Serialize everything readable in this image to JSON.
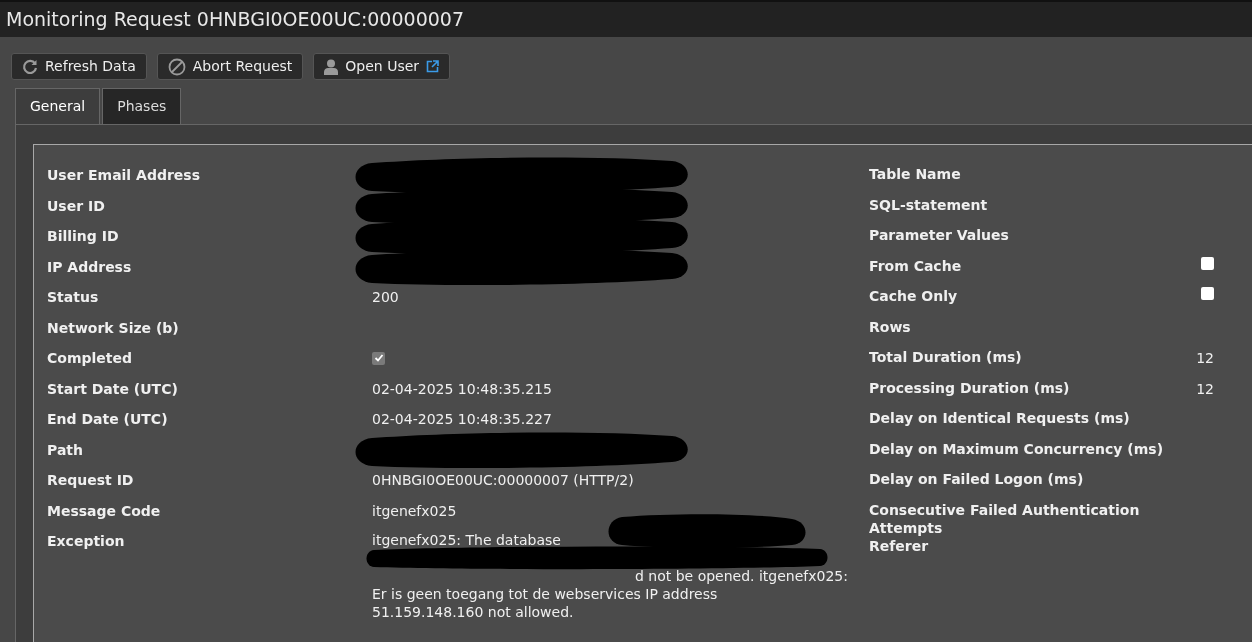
{
  "window": {
    "title": "Monitoring Request 0HNBGI0OE00UC:00000007"
  },
  "toolbar": [
    {
      "label": "Refresh Data"
    },
    {
      "label": "Abort Request"
    },
    {
      "label": "Open User"
    }
  ],
  "tabs": [
    {
      "label": "General",
      "selected": true
    },
    {
      "label": "Phases",
      "selected": false
    }
  ],
  "left_fields": [
    {
      "label": "User Email Address",
      "kind": "text",
      "redacted": true
    },
    {
      "label": "User ID",
      "kind": "text",
      "redacted": true
    },
    {
      "label": "Billing ID",
      "kind": "text",
      "redacted": true
    },
    {
      "label": "IP Address",
      "kind": "text",
      "redacted": true
    },
    {
      "label": "Status",
      "kind": "text",
      "value": "200",
      "redacted": false
    },
    {
      "label": "Network Size (b)",
      "kind": "text",
      "redacted": false
    },
    {
      "label": "Completed",
      "kind": "checkbox",
      "checked": true,
      "redacted": false
    },
    {
      "label": "Start Date (UTC)",
      "kind": "text",
      "value": "02-04-2025 10:48:35.215",
      "redacted": false
    },
    {
      "label": "End Date (UTC)",
      "kind": "text",
      "value": "02-04-2025 10:48:35.227",
      "redacted": false
    },
    {
      "label": "Path",
      "kind": "text",
      "redacted": true
    },
    {
      "label": "Request ID",
      "kind": "text",
      "value": "0HNBGI0OE00UC:00000007 (HTTP/2)",
      "redacted": false
    },
    {
      "label": "Message Code",
      "kind": "text",
      "value": "itgenefx025",
      "redacted": false
    },
    {
      "label": "Exception",
      "kind": "lines",
      "redacted": true,
      "lines": [
        "itgenefx025: The database",
        "d not be opened. itgenefx025:",
        "Er is geen toegang tot de webservices IP address",
        "51.159.148.160 not allowed."
      ]
    }
  ],
  "right_fields": [
    {
      "label": "Table Name",
      "kind": "text"
    },
    {
      "label": "SQL-statement",
      "kind": "text"
    },
    {
      "label": "Parameter Values",
      "kind": "text"
    },
    {
      "label": "From Cache",
      "kind": "checkbox",
      "checked": false
    },
    {
      "label": "Cache Only",
      "kind": "checkbox",
      "checked": false
    },
    {
      "label": "Rows",
      "kind": "text"
    },
    {
      "label": "Total Duration (ms)",
      "kind": "text",
      "value": "12"
    },
    {
      "label": "Processing Duration (ms)",
      "kind": "text",
      "value": "12"
    },
    {
      "label": "Delay on Identical Requests (ms)",
      "kind": "text"
    },
    {
      "label": "Delay on Maximum Concurrency (ms)",
      "kind": "text"
    },
    {
      "label": "Delay on Failed Logon (ms)",
      "kind": "text"
    },
    {
      "label": "Consecutive Failed Authentication Attempts",
      "kind": "text"
    },
    {
      "label": "Referer",
      "kind": "text"
    }
  ]
}
